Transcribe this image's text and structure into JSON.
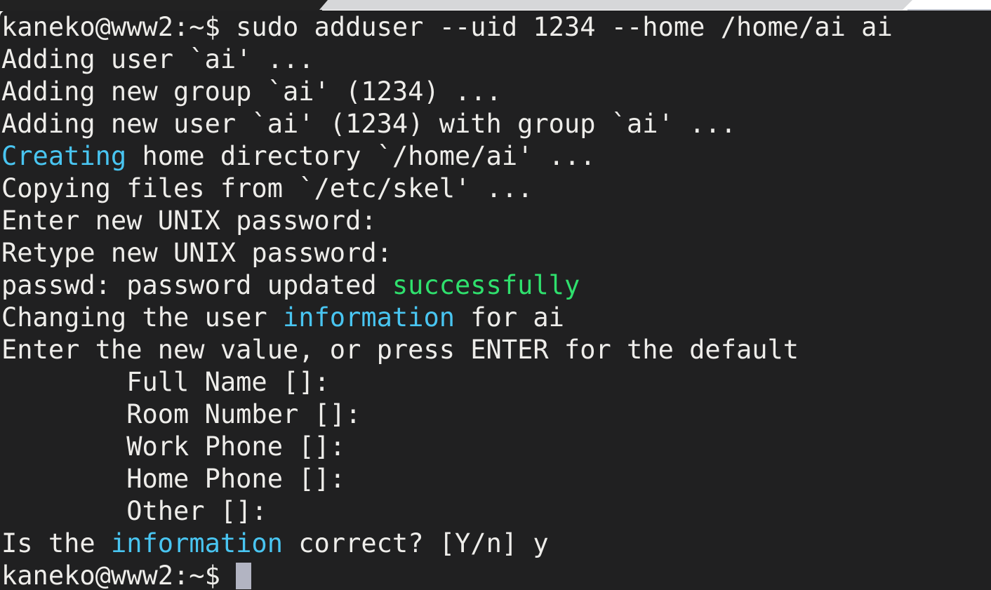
{
  "window": {
    "chrome_tab_name": "terminal-window-tab",
    "background_color": "#202021",
    "foreground_color": "#eeedea",
    "accent_cyan": "#49c5f1",
    "accent_green": "#2fe06d",
    "cursor_color": "#b2b4c2"
  },
  "terminal": {
    "prompt": "kaneko@www2:~$",
    "command": " sudo adduser --uid 1234 --home /home/ai ai",
    "lines": [
      {
        "id": "line-1",
        "segments": [
          {
            "text": "kaneko@www2:~$ sudo adduser --uid 1234 --home /home/ai ai",
            "color": "fg"
          }
        ]
      },
      {
        "id": "line-2",
        "segments": [
          {
            "text": "Adding user `ai' ...",
            "color": "fg"
          }
        ]
      },
      {
        "id": "line-3",
        "segments": [
          {
            "text": "Adding new group `ai' (1234) ...",
            "color": "fg"
          }
        ]
      },
      {
        "id": "line-4",
        "segments": [
          {
            "text": "Adding new user `ai' (1234) with group `ai' ...",
            "color": "fg"
          }
        ]
      },
      {
        "id": "line-5",
        "segments": [
          {
            "text": "Creating",
            "color": "cyan"
          },
          {
            "text": " home directory `/home/ai' ...",
            "color": "fg"
          }
        ]
      },
      {
        "id": "line-6",
        "segments": [
          {
            "text": "Copying files from `/etc/skel' ...",
            "color": "fg"
          }
        ]
      },
      {
        "id": "line-7",
        "segments": [
          {
            "text": "Enter new UNIX password:",
            "color": "fg"
          }
        ]
      },
      {
        "id": "line-8",
        "segments": [
          {
            "text": "Retype new UNIX password:",
            "color": "fg"
          }
        ]
      },
      {
        "id": "line-9",
        "segments": [
          {
            "text": "passwd: password updated ",
            "color": "fg"
          },
          {
            "text": "successfully",
            "color": "green"
          }
        ]
      },
      {
        "id": "line-10",
        "segments": [
          {
            "text": "Changing the user ",
            "color": "fg"
          },
          {
            "text": "information",
            "color": "cyan"
          },
          {
            "text": " for ai",
            "color": "fg"
          }
        ]
      },
      {
        "id": "line-11",
        "segments": [
          {
            "text": "Enter the new value, or press ENTER for the default",
            "color": "fg"
          }
        ]
      },
      {
        "id": "line-12",
        "segments": [
          {
            "text": "        Full Name []:",
            "color": "fg"
          }
        ]
      },
      {
        "id": "line-13",
        "segments": [
          {
            "text": "        Room Number []:",
            "color": "fg"
          }
        ]
      },
      {
        "id": "line-14",
        "segments": [
          {
            "text": "        Work Phone []:",
            "color": "fg"
          }
        ]
      },
      {
        "id": "line-15",
        "segments": [
          {
            "text": "        Home Phone []:",
            "color": "fg"
          }
        ]
      },
      {
        "id": "line-16",
        "segments": [
          {
            "text": "        Other []:",
            "color": "fg"
          }
        ]
      },
      {
        "id": "line-17",
        "segments": [
          {
            "text": "Is the ",
            "color": "fg"
          },
          {
            "text": "information",
            "color": "cyan"
          },
          {
            "text": " correct? [Y/n] y",
            "color": "fg"
          }
        ]
      },
      {
        "id": "line-18",
        "segments": [
          {
            "text": "kaneko@www2:~$ ",
            "color": "fg"
          }
        ],
        "cursor": true
      }
    ]
  }
}
